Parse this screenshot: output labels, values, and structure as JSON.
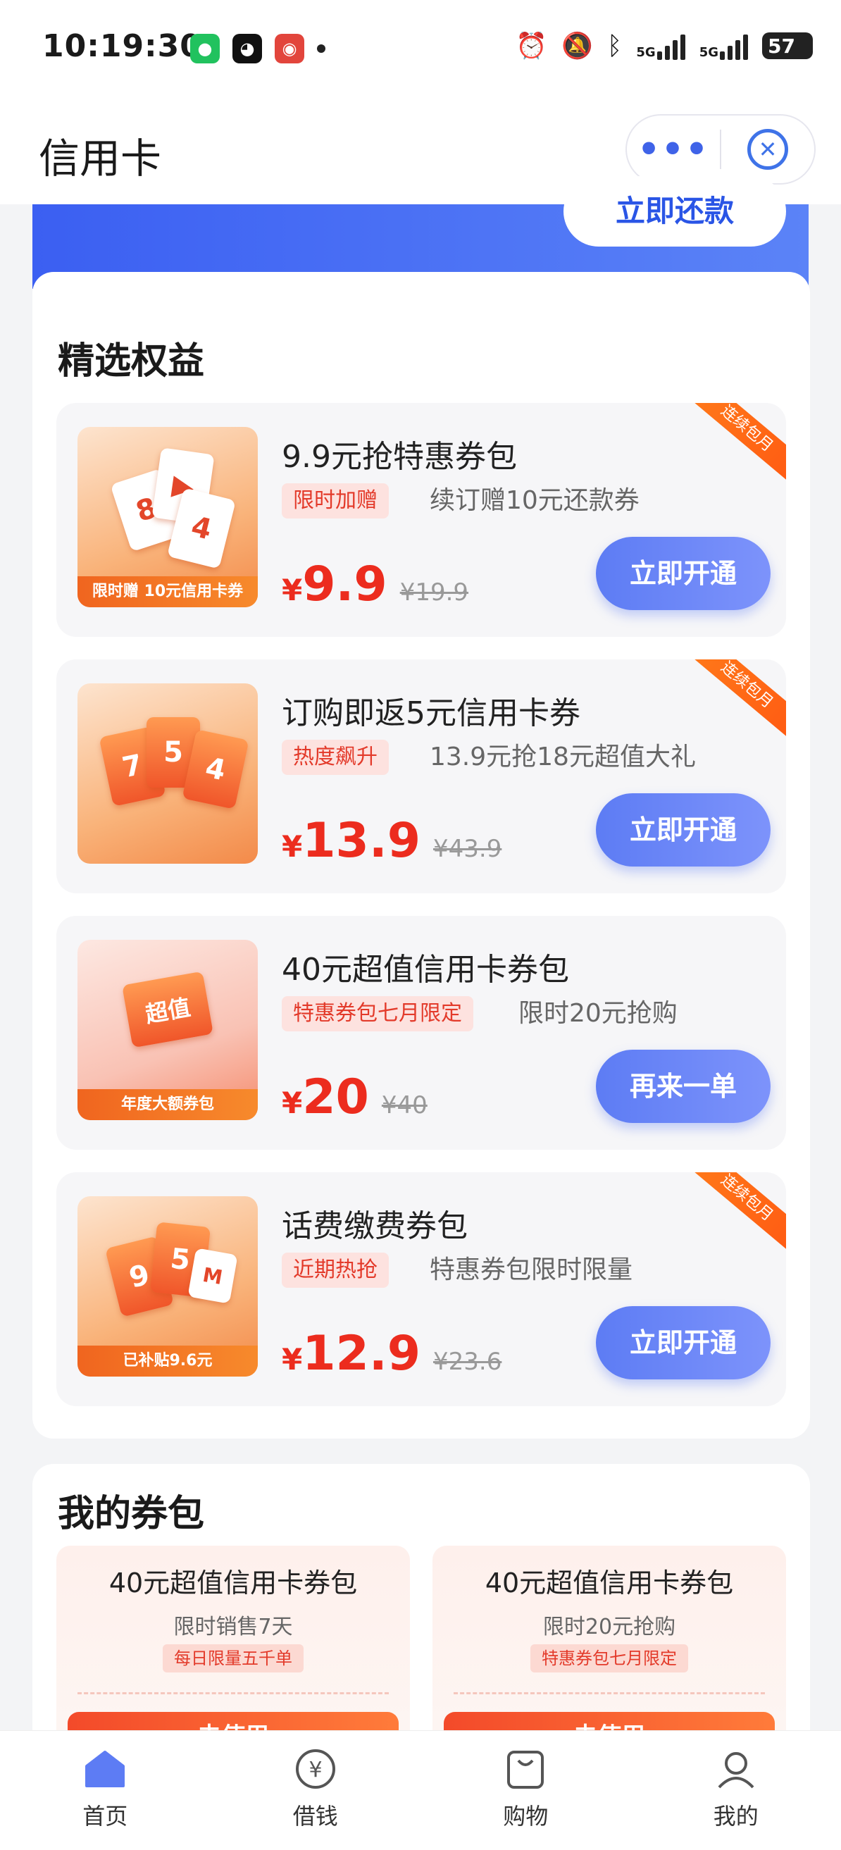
{
  "status_bar": {
    "time": "10:19:30",
    "network_1": "5G",
    "network_2": "5G",
    "battery": "57"
  },
  "app_bar": {
    "title": "信用卡",
    "more_icon": "more-dots-icon",
    "close_icon": "close-circle-icon"
  },
  "banner": {
    "repay_label": "立即还款"
  },
  "benefits": {
    "title": "精选权益",
    "items": [
      {
        "title": "9.9元抢特惠券包",
        "tag": "限时加赠",
        "subtitle": "续订赠10元还款券",
        "price_symbol": "¥",
        "price": "9.9",
        "original_price": "¥19.9",
        "button": "立即开通",
        "ribbon": "连续包月",
        "thumb_caption": "限时赠 10元信用卡券"
      },
      {
        "title": "订购即返5元信用卡券",
        "tag": "热度飙升",
        "subtitle": "13.9元抢18元超值大礼",
        "price_symbol": "¥",
        "price": "13.9",
        "original_price": "¥43.9",
        "button": "立即开通",
        "ribbon": "连续包月",
        "thumb_caption": ""
      },
      {
        "title": "40元超值信用卡券包",
        "tag": "特惠券包七月限定",
        "subtitle": "限时20元抢购",
        "price_symbol": "¥",
        "price": "20",
        "original_price": "¥40",
        "button": "再来一单",
        "ribbon": "",
        "thumb_caption": "年度大额券包"
      },
      {
        "title": "话费缴费券包",
        "tag": "近期热抢",
        "subtitle": "特惠券包限时限量",
        "price_symbol": "¥",
        "price": "12.9",
        "original_price": "¥23.6",
        "button": "立即开通",
        "ribbon": "连续包月",
        "thumb_caption": "已补贴9.6元"
      }
    ]
  },
  "my_coupons": {
    "title": "我的券包",
    "items": [
      {
        "title": "40元超值信用卡券包",
        "subtitle": "限时销售7天",
        "tag": "每日限量五千单",
        "button": "去使用"
      },
      {
        "title": "40元超值信用卡券包",
        "subtitle": "限时20元抢购",
        "tag": "特惠券包七月限定",
        "button": "去使用"
      }
    ]
  },
  "tab_bar": {
    "items": [
      {
        "label": "首页",
        "icon": "home-icon"
      },
      {
        "label": "借钱",
        "icon": "yuan-circle-icon"
      },
      {
        "label": "购物",
        "icon": "shopping-bag-icon"
      },
      {
        "label": "我的",
        "icon": "user-icon"
      }
    ]
  },
  "colors": {
    "accent_blue": "#5d7cf4",
    "price_red": "#ec2c1e",
    "ribbon_orange": "#ff6a12"
  }
}
